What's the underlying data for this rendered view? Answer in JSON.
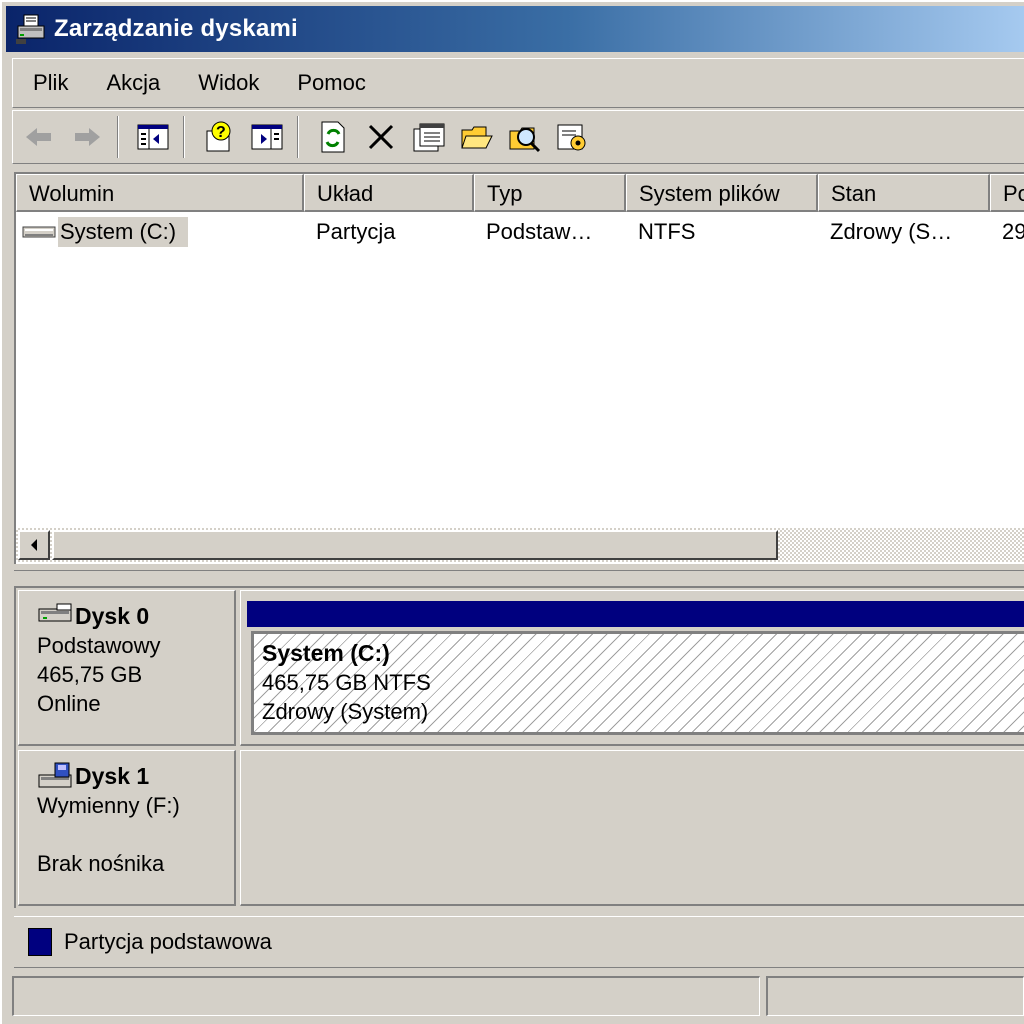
{
  "window": {
    "title": "Zarządzanie dyskami",
    "icon": "disk-management-icon"
  },
  "menu": {
    "items": [
      "Plik",
      "Akcja",
      "Widok",
      "Pomoc"
    ]
  },
  "toolbar": {
    "buttons": [
      "back-icon",
      "forward-icon",
      "show-hide-tree-icon",
      "help-icon",
      "show-hide-action-pane-icon",
      "refresh-icon",
      "delete-icon",
      "properties-icon",
      "open-icon",
      "explore-icon",
      "settings-icon"
    ]
  },
  "volume_list": {
    "columns": [
      "Wolumin",
      "Układ",
      "Typ",
      "System plików",
      "Stan",
      "Po"
    ],
    "rows": [
      {
        "volume": "System (C:)",
        "layout": "Partycja",
        "type": "Podstaw…",
        "filesystem": "NTFS",
        "status": "Zdrowy (S…",
        "capacity": "29"
      }
    ]
  },
  "disks": [
    {
      "name": "Dysk 0",
      "type": "Podstawowy",
      "size": "465,75 GB",
      "state": "Online",
      "partition": {
        "name": "System  (C:)",
        "detail": "465,75 GB NTFS",
        "status": "Zdrowy (System)"
      }
    },
    {
      "name": "Dysk 1",
      "type": "Wymienny (F:)",
      "state": "Brak nośnika"
    }
  ],
  "legend": {
    "label": "Partycja podstawowa",
    "color": "#00007f"
  },
  "colors": {
    "titlebar_start": "#0a246a",
    "titlebar_end": "#a6caf0",
    "face": "#d4d0c8",
    "primary_partition": "#00007f"
  }
}
